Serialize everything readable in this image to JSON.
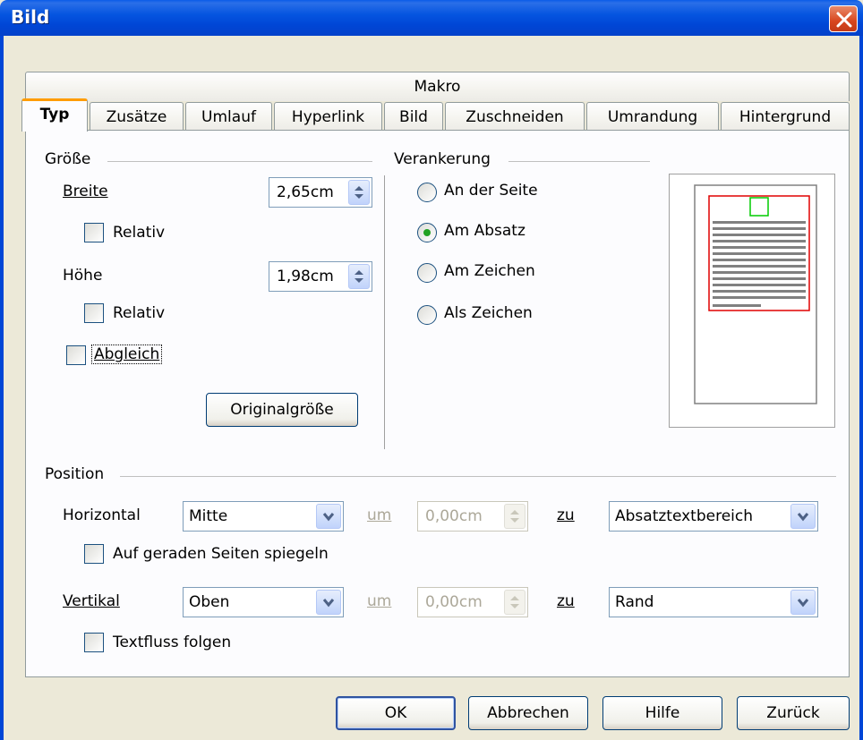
{
  "window": {
    "title": "Bild"
  },
  "tabs_row1": [
    {
      "label": "Makro"
    }
  ],
  "tabs_row2": [
    {
      "label": "Typ",
      "active": true
    },
    {
      "label": "Zusätze"
    },
    {
      "label": "Umlauf"
    },
    {
      "label": "Hyperlink"
    },
    {
      "label": "Bild"
    },
    {
      "label": "Zuschneiden"
    },
    {
      "label": "Umrandung"
    },
    {
      "label": "Hintergrund"
    }
  ],
  "groesse": {
    "title": "Größe",
    "breite_label": "Breite",
    "breite_value": "2,65cm",
    "relativ_label": "Relativ",
    "hoehe_label": "Höhe",
    "hoehe_value": "1,98cm",
    "abgleich_label": "Abgleich",
    "original_button": "Originalgröße"
  },
  "verankerung": {
    "title": "Verankerung",
    "options": [
      {
        "label": "An der Seite",
        "checked": false
      },
      {
        "label": "Am Absatz",
        "checked": true
      },
      {
        "label": "Am Zeichen",
        "checked": false
      },
      {
        "label": "Als Zeichen",
        "checked": false
      }
    ]
  },
  "position": {
    "title": "Position",
    "horizontal_label": "Horizontal",
    "horizontal_value": "Mitte",
    "um_label": "um",
    "horizontal_um_value": "0,00cm",
    "zu_label": "zu",
    "horizontal_zu_value": "Absatztextbereich",
    "spiegeln_label": "Auf geraden Seiten spiegeln",
    "vertikal_label": "Vertikal",
    "vertikal_value": "Oben",
    "vertikal_um_value": "0,00cm",
    "vertikal_zu_value": "Rand",
    "textfluss_label": "Textfluss folgen"
  },
  "buttons": {
    "ok": "OK",
    "abbrechen": "Abbrechen",
    "hilfe": "Hilfe",
    "zurueck": "Zurück"
  },
  "colors": {
    "titlebar": "#0046d6",
    "active_tab_accent": "#ff9c00",
    "radio_dot": "#21a121",
    "preview_frame": "#e00000",
    "preview_anchor": "#00cc00"
  }
}
